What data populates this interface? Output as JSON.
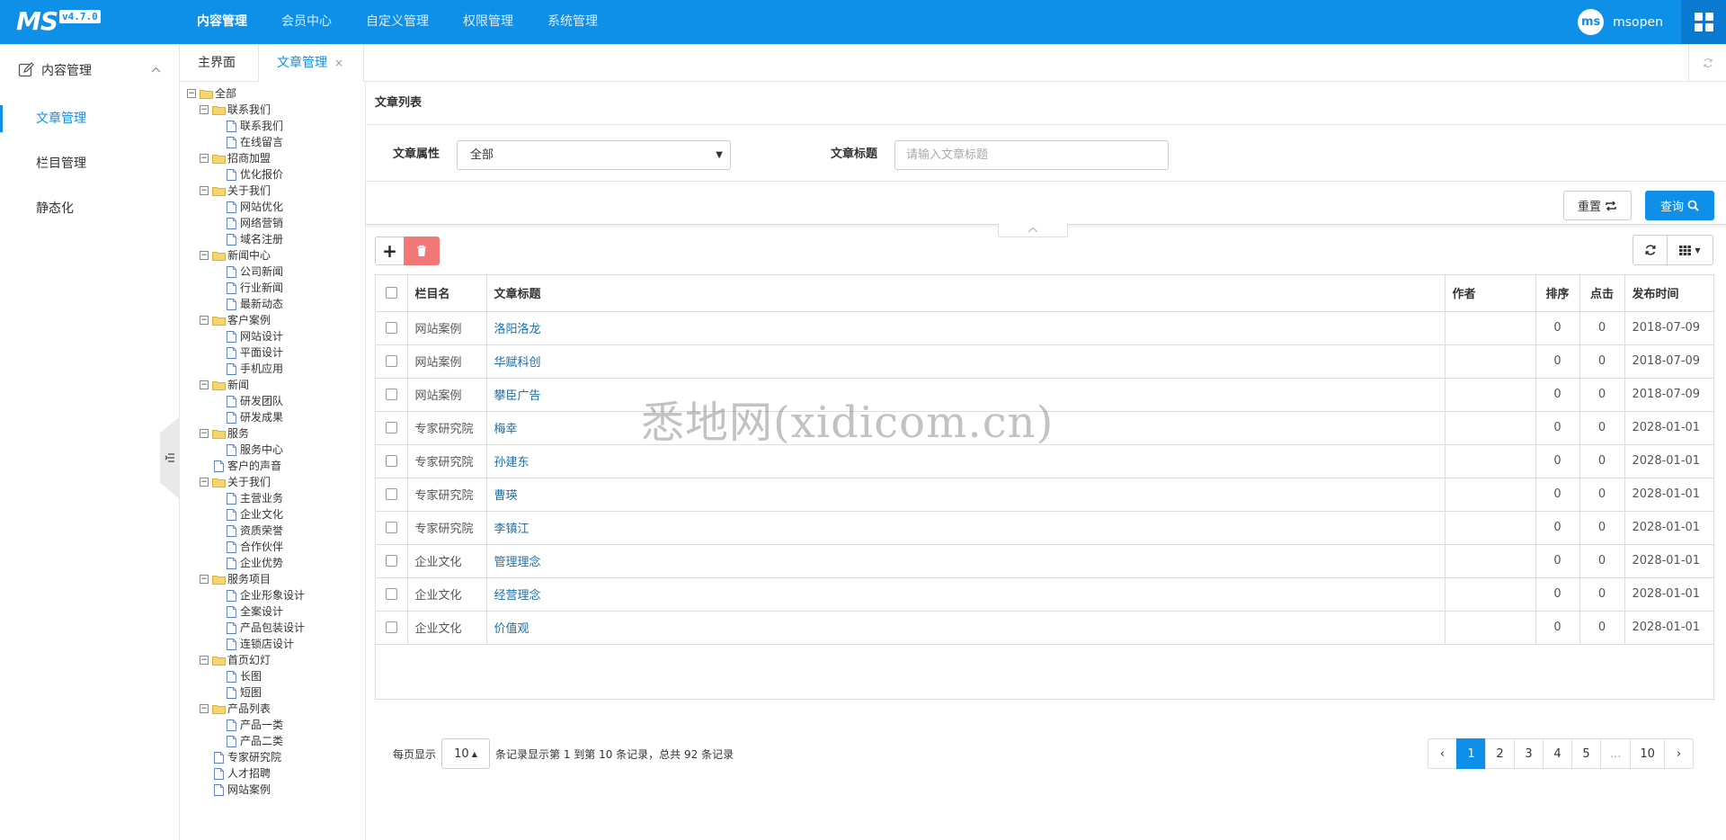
{
  "app": {
    "logo": "MS",
    "version": "v4.7.0"
  },
  "topnav": [
    "内容管理",
    "会员中心",
    "自定义管理",
    "权限管理",
    "系统管理"
  ],
  "user": {
    "avatar_text": "ms",
    "name": "msopen"
  },
  "sidebar": {
    "section": "内容管理",
    "items": [
      "文章管理",
      "栏目管理",
      "静态化"
    ]
  },
  "tabs": {
    "home": "主界面",
    "current": "文章管理",
    "close": "×"
  },
  "tree": [
    {
      "depth": 0,
      "label": "全部",
      "type": "folder",
      "toggle": "−"
    },
    {
      "depth": 1,
      "label": "联系我们",
      "type": "folder",
      "toggle": "−"
    },
    {
      "depth": 2,
      "label": "联系我们",
      "type": "doc"
    },
    {
      "depth": 2,
      "label": "在线留言",
      "type": "doc"
    },
    {
      "depth": 1,
      "label": "招商加盟",
      "type": "folder",
      "toggle": "−"
    },
    {
      "depth": 2,
      "label": "优化报价",
      "type": "doc"
    },
    {
      "depth": 1,
      "label": "关于我们",
      "type": "folder",
      "toggle": "−"
    },
    {
      "depth": 2,
      "label": "网站优化",
      "type": "doc"
    },
    {
      "depth": 2,
      "label": "网络营销",
      "type": "doc"
    },
    {
      "depth": 2,
      "label": "域名注册",
      "type": "doc"
    },
    {
      "depth": 1,
      "label": "新闻中心",
      "type": "folder",
      "toggle": "−"
    },
    {
      "depth": 2,
      "label": "公司新闻",
      "type": "doc"
    },
    {
      "depth": 2,
      "label": "行业新闻",
      "type": "doc"
    },
    {
      "depth": 2,
      "label": "最新动态",
      "type": "doc"
    },
    {
      "depth": 1,
      "label": "客户案例",
      "type": "folder",
      "toggle": "−"
    },
    {
      "depth": 2,
      "label": "网站设计",
      "type": "doc"
    },
    {
      "depth": 2,
      "label": "平面设计",
      "type": "doc"
    },
    {
      "depth": 2,
      "label": "手机应用",
      "type": "doc"
    },
    {
      "depth": 1,
      "label": "新闻",
      "type": "folder",
      "toggle": "−"
    },
    {
      "depth": 2,
      "label": "研发团队",
      "type": "doc"
    },
    {
      "depth": 2,
      "label": "研发成果",
      "type": "doc"
    },
    {
      "depth": 1,
      "label": "服务",
      "type": "folder",
      "toggle": "−"
    },
    {
      "depth": 2,
      "label": "服务中心",
      "type": "doc"
    },
    {
      "depth": 1,
      "label": "客户的声音",
      "type": "doc"
    },
    {
      "depth": 1,
      "label": "关于我们",
      "type": "folder",
      "toggle": "−"
    },
    {
      "depth": 2,
      "label": "主营业务",
      "type": "doc"
    },
    {
      "depth": 2,
      "label": "企业文化",
      "type": "doc"
    },
    {
      "depth": 2,
      "label": "资质荣誉",
      "type": "doc"
    },
    {
      "depth": 2,
      "label": "合作伙伴",
      "type": "doc"
    },
    {
      "depth": 2,
      "label": "企业优势",
      "type": "doc"
    },
    {
      "depth": 1,
      "label": "服务项目",
      "type": "folder",
      "toggle": "−"
    },
    {
      "depth": 2,
      "label": "企业形象设计",
      "type": "doc"
    },
    {
      "depth": 2,
      "label": " 全案设计",
      "type": "doc"
    },
    {
      "depth": 2,
      "label": "产品包装设计",
      "type": "doc"
    },
    {
      "depth": 2,
      "label": "连锁店设计",
      "type": "doc"
    },
    {
      "depth": 1,
      "label": "首页幻灯",
      "type": "folder",
      "toggle": "−"
    },
    {
      "depth": 2,
      "label": "长图",
      "type": "doc"
    },
    {
      "depth": 2,
      "label": "短图",
      "type": "doc"
    },
    {
      "depth": 1,
      "label": "产品列表",
      "type": "folder",
      "toggle": "−"
    },
    {
      "depth": 2,
      "label": "产品一类",
      "type": "doc"
    },
    {
      "depth": 2,
      "label": "产品二类",
      "type": "doc"
    },
    {
      "depth": 1,
      "label": "专家研究院",
      "type": "doc"
    },
    {
      "depth": 1,
      "label": "人才招聘",
      "type": "doc"
    },
    {
      "depth": 1,
      "label": "网站案例",
      "type": "doc"
    }
  ],
  "main": {
    "title": "文章列表",
    "filter": {
      "attr_label": "文章属性",
      "attr_value": "全部",
      "title_label": "文章标题",
      "title_placeholder": "请输入文章标题"
    },
    "buttons": {
      "reset": "重置",
      "query": "查询"
    },
    "table": {
      "headers": [
        "栏目名",
        "文章标题",
        "作者",
        "排序",
        "点击",
        "发布时间"
      ],
      "rows": [
        {
          "category": "网站案例",
          "title": "洛阳洛龙",
          "author": "",
          "order": "0",
          "clicks": "0",
          "date": "2018-07-09"
        },
        {
          "category": "网站案例",
          "title": "华赋科创",
          "author": "",
          "order": "0",
          "clicks": "0",
          "date": "2018-07-09"
        },
        {
          "category": "网站案例",
          "title": "攀臣广告",
          "author": "",
          "order": "0",
          "clicks": "0",
          "date": "2018-07-09"
        },
        {
          "category": "专家研究院",
          "title": "梅幸",
          "author": "",
          "order": "0",
          "clicks": "0",
          "date": "2028-01-01"
        },
        {
          "category": "专家研究院",
          "title": "孙建东",
          "author": "",
          "order": "0",
          "clicks": "0",
          "date": "2028-01-01"
        },
        {
          "category": "专家研究院",
          "title": "曹瑛",
          "author": "",
          "order": "0",
          "clicks": "0",
          "date": "2028-01-01"
        },
        {
          "category": "专家研究院",
          "title": "李镇江",
          "author": "",
          "order": "0",
          "clicks": "0",
          "date": "2028-01-01"
        },
        {
          "category": "企业文化",
          "title": "管理理念",
          "author": "",
          "order": "0",
          "clicks": "0",
          "date": "2028-01-01"
        },
        {
          "category": "企业文化",
          "title": "经营理念",
          "author": "",
          "order": "0",
          "clicks": "0",
          "date": "2028-01-01"
        },
        {
          "category": "企业文化",
          "title": "价值观",
          "author": "",
          "order": "0",
          "clicks": "0",
          "date": "2028-01-01"
        }
      ]
    },
    "pagination": {
      "per_page_label": "每页显示",
      "page_size": "10",
      "summary": "条记录显示第 1 到第 10 条记录，总共 92 条记录",
      "prev": "‹",
      "pages": [
        "1",
        "2",
        "3",
        "4",
        "5",
        "...",
        "10"
      ],
      "active": "1",
      "next": "›"
    }
  },
  "watermark": "悉地网(xidicom.cn)",
  "colors": {
    "primary": "#0e90e8",
    "danger": "#f27777",
    "link": "#1d6fa5"
  }
}
